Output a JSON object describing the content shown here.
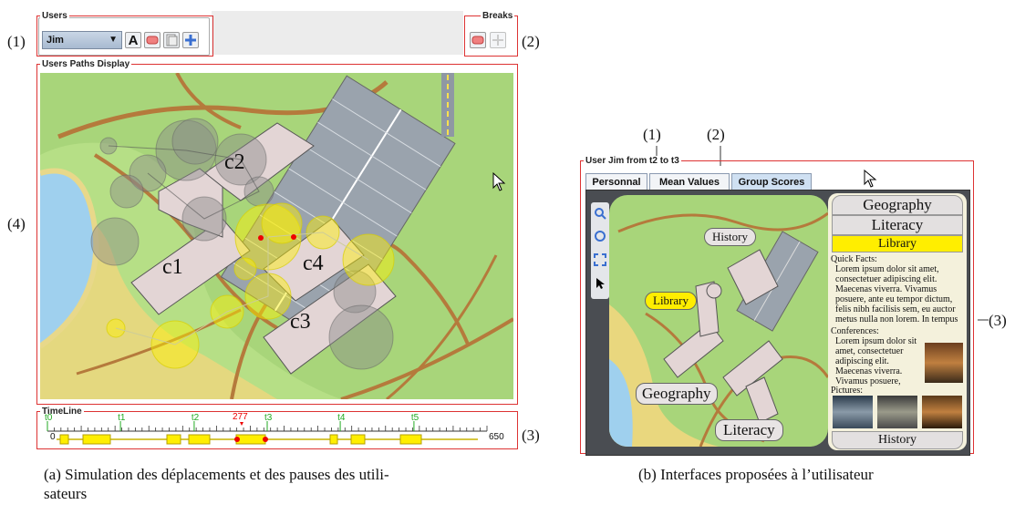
{
  "left_panel": {
    "users_group": {
      "title": "Users",
      "selected_user": "Jim",
      "font_button": "A"
    },
    "breaks_group": {
      "title": "Breaks"
    },
    "display_group": {
      "title": "Users Paths Display"
    },
    "map_labels": {
      "c1": "c1",
      "c2": "c2",
      "c3": "c3",
      "c4": "c4"
    },
    "timeline": {
      "title": "TimeLine",
      "start": "0",
      "end": "650",
      "current": "277",
      "marks": [
        {
          "label": "t0",
          "value": 0
        },
        {
          "label": "t1",
          "value": 108
        },
        {
          "label": "t2",
          "value": 217
        },
        {
          "label": "t3",
          "value": 325
        },
        {
          "label": "t4",
          "value": 433
        },
        {
          "label": "t5",
          "value": 542
        }
      ]
    },
    "callouts": {
      "c1": "(1)",
      "c2": "(2)",
      "c3": "(3)",
      "c4": "(4)"
    }
  },
  "right_panel": {
    "group_title": "User Jim from t2 to t3",
    "tabs": [
      "Personnal",
      "Mean Values",
      "Group Scores"
    ],
    "active_tab": "Group Scores",
    "tool_icons": [
      "zoom-icon",
      "refresh-icon",
      "fit-icon",
      "pointer-icon"
    ],
    "bubbles": {
      "history": "History",
      "library": "Library",
      "geography": "Geography",
      "literacy": "Literacy"
    },
    "side": {
      "header1": "Geography",
      "header2": "Literacy",
      "header3": "Library",
      "quick_facts_title": "Quick Facts:",
      "quick_facts_text": "Lorem ipsum dolor sit amet, consectetuer adipiscing elit. Maecenas viverra. Vivamus posuere, ante eu tempor dictum, felis nibh facilisis sem, eu auctor metus nulla non lorem. In tempus",
      "conferences_title": "Conferences:",
      "conferences_text": "Lorem ipsum dolor sit amet, consectetuer adipiscing elit. Maecenas viverra. Vivamus posuere,",
      "pictures_title": "Pictures:",
      "footer": "History"
    },
    "callouts": {
      "c1": "(1)",
      "c2": "(2)",
      "c3": "(3)"
    }
  },
  "captions": {
    "a": "(a) Simulation des déplacements et des pauses des utili-\nsateurs",
    "b": "(b) Interfaces proposées à l’utilisateur"
  },
  "colors": {
    "annotation_red": "#dd3333",
    "grass": "#a8d57a",
    "timeline_green": "#22aa22",
    "pause_yellow": "#ffee00"
  }
}
